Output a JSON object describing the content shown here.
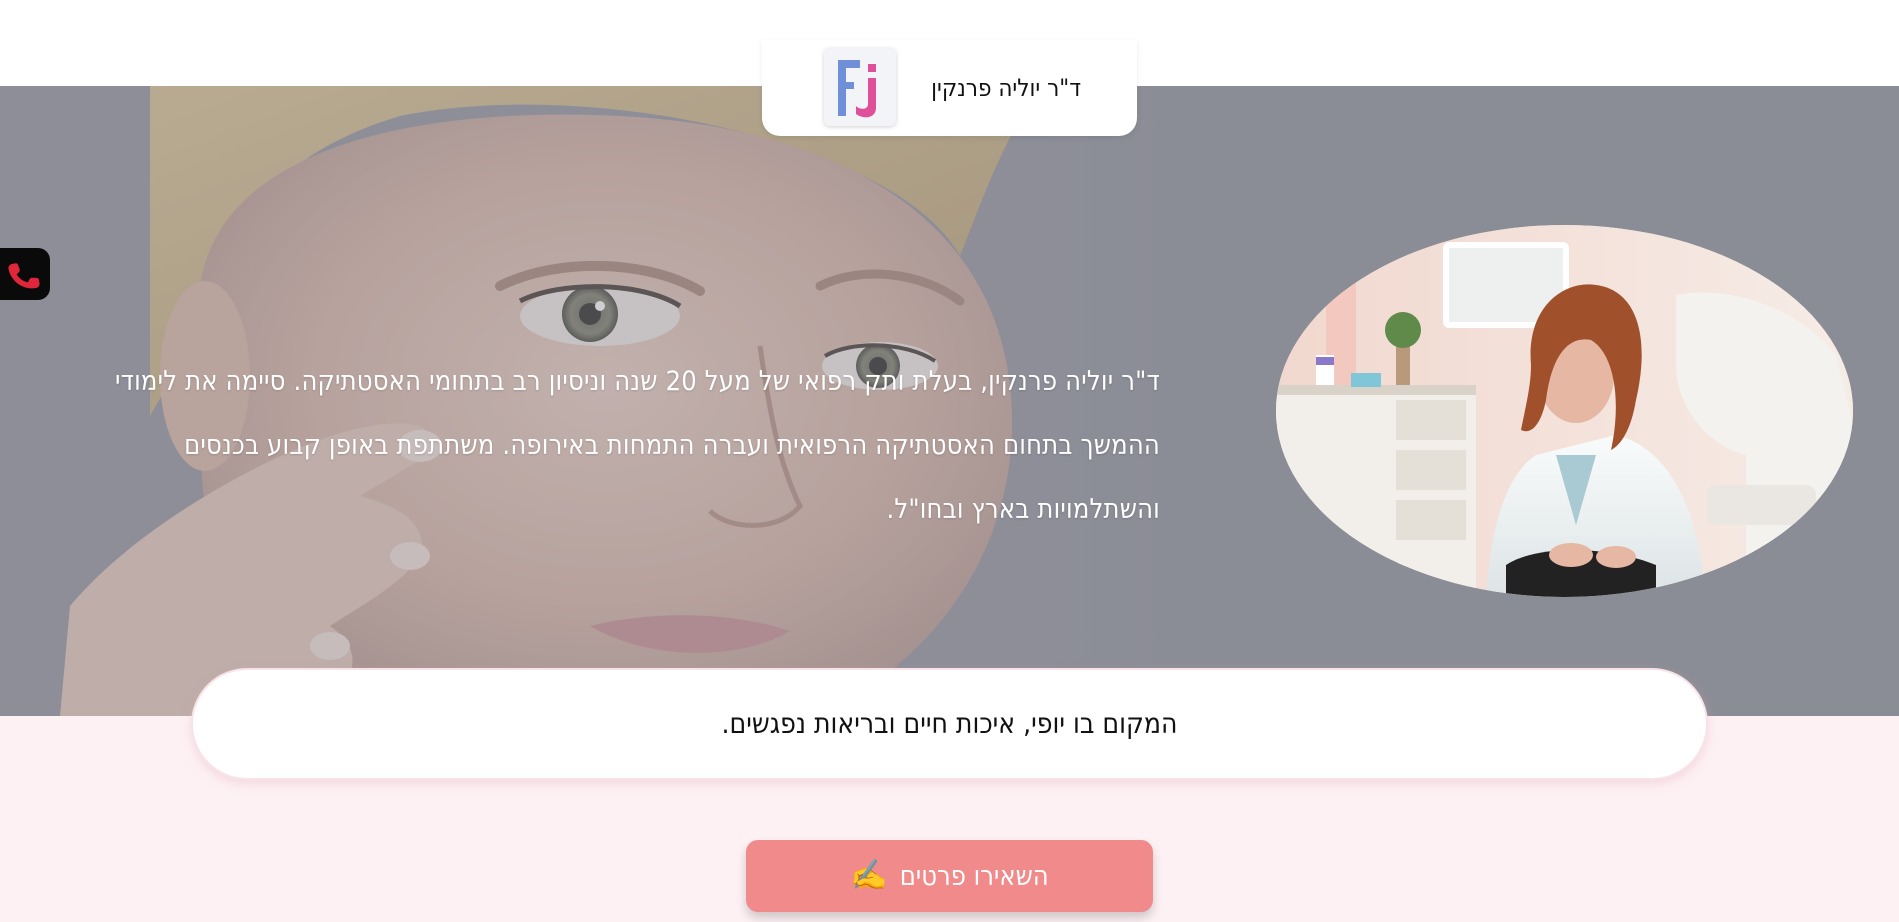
{
  "header": {
    "logo_icon": "fj-monogram-logo",
    "clinic_name": "ד\"ר יוליה פרנקין"
  },
  "hero": {
    "background_image": "woman-face-skincare-photo",
    "intro_text": "ד\"ר יוליה פרנקין, בעלת ותק רפואי של מעל 20 שנה וניסיון רב בתחומי האסטתיקה. סיימה את לימודי ההמשך בתחום האסטתיקה הרפואית ועברה התמחות באירופה. משתתפת באופן קבוע בכנסים והשתלמויות בארץ ובחו\"ל.",
    "doctor_photo": "doctor-portrait-photo"
  },
  "contact": {
    "phone_icon": "phone-icon"
  },
  "tagline": "המקום בו יופי, איכות חיים ובריאות נפגשים.",
  "cta": {
    "label": "השאירו פרטים",
    "icon": "✍️"
  },
  "colors": {
    "hero_overlay": "#8b8d96",
    "page_background": "#fdf1f4",
    "cta_background": "#f08a8b",
    "logo_blue": "#6f8fd8",
    "logo_pink": "#e0509a",
    "phone_red": "#e0263a"
  }
}
